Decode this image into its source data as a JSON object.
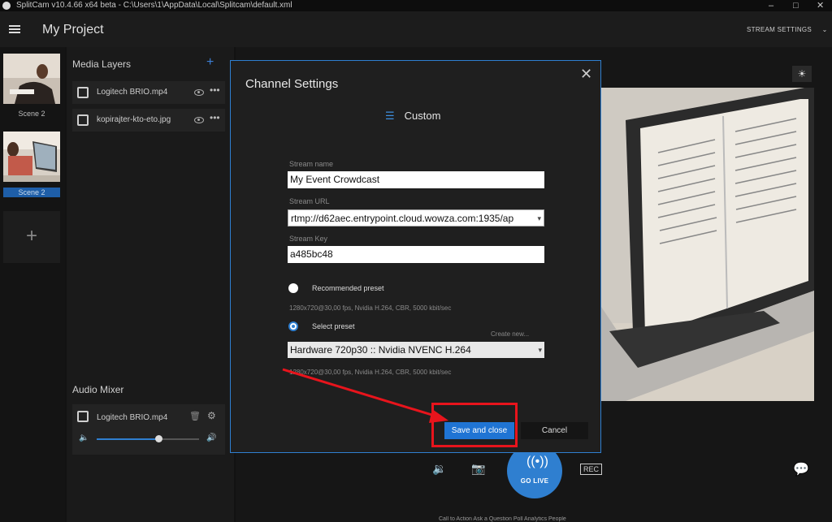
{
  "titlebar": {
    "title": "SplitCam v10.4.66 x64 beta - C:\\Users\\1\\AppData\\Local\\Splitcam\\default.xml",
    "controls": [
      "–",
      "□",
      "✕"
    ]
  },
  "header": {
    "project_title": "My Project",
    "stream_settings": "STREAM SETTINGS",
    "stream_settings_chevron": "⌄"
  },
  "scenes": {
    "items": [
      {
        "label": "Scene 2",
        "active": false
      },
      {
        "label": "Scene 2",
        "active": true
      }
    ],
    "add_glyph": "+"
  },
  "media_layers": {
    "title": "Media Layers",
    "add_glyph": "+",
    "items": [
      {
        "name": "Logitech BRIO.mp4",
        "icon": "video-icon"
      },
      {
        "name": "kopirajter-kto-eto.jpg",
        "icon": "image-icon"
      }
    ],
    "more_glyph": "•••"
  },
  "audio_mixer": {
    "title": "Audio Mixer",
    "item_name": "Logitech BRIO.mp4",
    "volume_level": 0.6
  },
  "dialog": {
    "title": "Channel Settings",
    "close_glyph": "✕",
    "service_label": "Custom",
    "stream_name_label": "Stream name",
    "stream_name_value": "My Event Crowdcast",
    "stream_url_label": "Stream URL",
    "stream_url_value": "rtmp://d62aec.entrypoint.cloud.wowza.com:1935/ap",
    "stream_key_label": "Stream Key",
    "stream_key_value": "a485bc48",
    "recommended_preset_label": "Recommended preset",
    "recommended_preset_desc": "1280x720@30,00 fps, Nvidia H.264, CBR, 5000 kbit/sec",
    "select_preset_label": "Select preset",
    "create_new_label": "Create new...",
    "preset_value": "Hardware 720p30 :: Nvidia NVENC H.264",
    "select_preset_desc": "1280x720@30,00 fps, Nvidia H.264, CBR, 5000 kbit/sec",
    "selected_option": "select_preset",
    "save_label": "Save and close",
    "cancel_label": "Cancel"
  },
  "controls": {
    "go_live_label": "GO LIVE"
  },
  "bottom_strip": {
    "text": "Call to Action   Ask a Question   Poll   Analytics   People"
  },
  "colors": {
    "accent": "#2f7fd0",
    "highlight": "#e8141c",
    "dialog_bg": "#1f1f1f",
    "app_bg": "#121212"
  }
}
